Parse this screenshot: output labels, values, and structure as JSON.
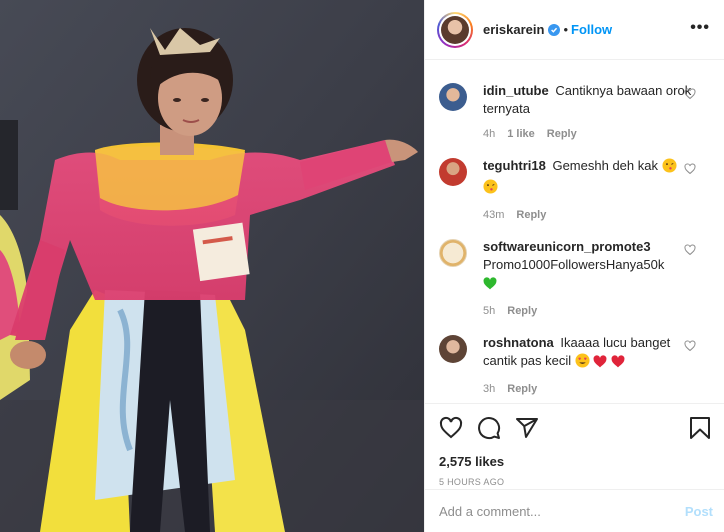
{
  "post": {
    "username": "eriskarein",
    "follow_label": "Follow",
    "dot": "•",
    "more_label": "•••"
  },
  "comments": [
    {
      "user": "idin_utube",
      "text": "Cantiknya bawaan orok ternyata",
      "emoji": [],
      "time": "4h",
      "likes": "1 like",
      "reply": "Reply",
      "avatar_color": "#4b6c9e"
    },
    {
      "user": "teguhtri18",
      "text": "Gemeshh deh kak",
      "emoji": [
        "kiss-emoji",
        "kiss-emoji"
      ],
      "time": "43m",
      "likes": "",
      "reply": "Reply",
      "avatar_color": "#c0392b"
    },
    {
      "user": "softwareunicorn_promote3",
      "text": "Promo1000FollowersHanya50k",
      "emoji": [
        "green-heart-emoji"
      ],
      "time": "5h",
      "likes": "",
      "reply": "Reply",
      "avatar_color": "#f3e3c3"
    },
    {
      "user": "roshnatona",
      "text": "Ikaaaa lucu banget cantik pas kecil",
      "emoji": [
        "heart-eyes-emoji",
        "red-heart-emoji",
        "red-heart-emoji"
      ],
      "time": "3h",
      "likes": "",
      "reply": "Reply",
      "avatar_color": "#8b6a55"
    }
  ],
  "actions": {
    "likes": "2,575 likes",
    "time": "5 HOURS AGO"
  },
  "add_comment": {
    "placeholder": "Add a comment...",
    "post_label": "Post"
  },
  "icons": [
    "heart-icon",
    "comment-icon",
    "share-icon",
    "save-icon",
    "verified-icon",
    "more-icon"
  ],
  "colors": {
    "follow": "#0095f6",
    "post_disabled": "#b2dffc",
    "muted": "#8e8e8e",
    "verified": "#3897f0"
  }
}
